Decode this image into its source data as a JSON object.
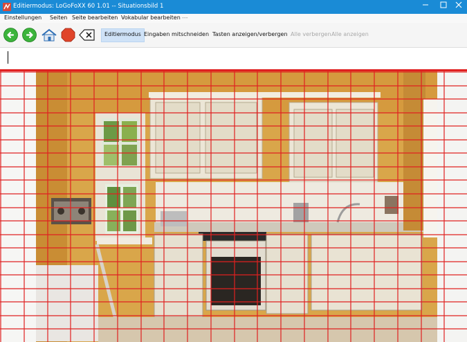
{
  "window": {
    "title": "Editiermodus: LoGoFoXX 60 1.01 -- Situationsbild 1",
    "controls": [
      "minimize-icon",
      "maximize-icon",
      "close-icon"
    ]
  },
  "menu": {
    "items": [
      "Einstellungen",
      "Seiten",
      "Seite bearbeiten",
      "Vokabular bearbeiten",
      "---"
    ]
  },
  "toolbar": {
    "icons": [
      "back-arrow-icon",
      "forward-arrow-icon",
      "home-icon",
      "stop-icon",
      "backspace-icon"
    ],
    "buttons": {
      "edit_mode": "Editiermodus",
      "record_input": "Eingaben mitschneiden",
      "toggle_keys": "Tasten anzeigen/verbergen",
      "hide_all": "Alle verbergen",
      "show_all": "Alle anzeigen"
    }
  },
  "input": {
    "value": ""
  },
  "colors": {
    "titlebar": "#1a8bd6",
    "grid": "#e02020",
    "accent_selected": "#cfe2f7"
  },
  "scene": {
    "subject": "kitchen photo with red grid overlay",
    "grid_columns": 20,
    "grid_rows": 20
  }
}
